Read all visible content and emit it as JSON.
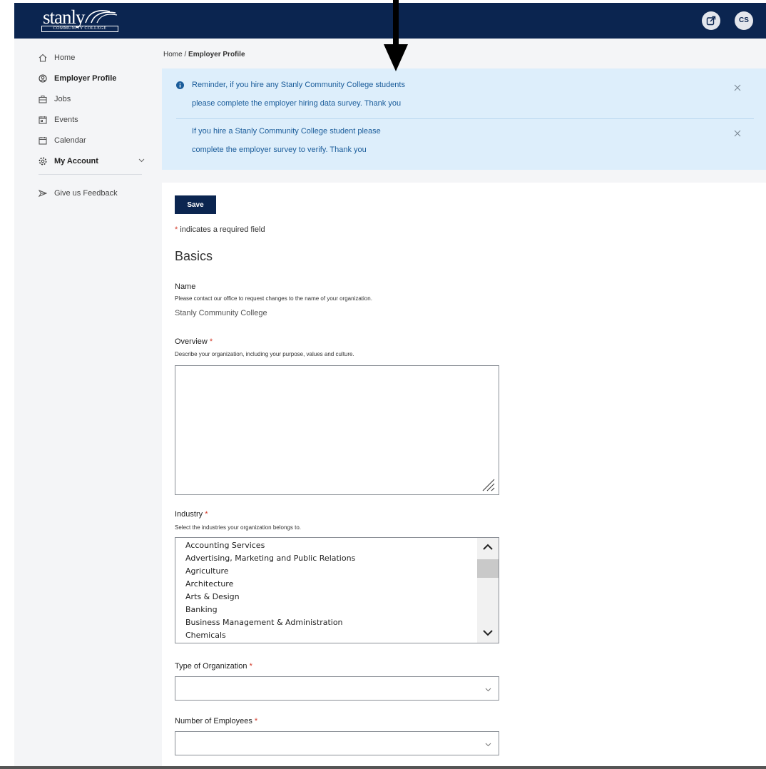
{
  "logo": {
    "wordmark": "stanly",
    "subline": "COMMUNITY COLLEGE"
  },
  "header": {
    "avatar_initials": "CS"
  },
  "sidebar": {
    "items": [
      {
        "label": "Home"
      },
      {
        "label": "Employer Profile"
      },
      {
        "label": "Jobs"
      },
      {
        "label": "Events"
      },
      {
        "label": "Calendar"
      },
      {
        "label": "My Account"
      },
      {
        "label": "Give us Feedback"
      }
    ]
  },
  "breadcrumb": {
    "home": "Home",
    "separator": "/",
    "current": "Employer Profile"
  },
  "alerts": [
    {
      "line1": "Reminder, if you hire any Stanly Community College students",
      "line2": "please complete the employer hiring data survey.  Thank you"
    },
    {
      "line1": "If you hire a Stanly Community College student please",
      "line2": "complete the employer survey to verify.  Thank you"
    }
  ],
  "form": {
    "save_label": "Save",
    "required_note": "indicates a required field",
    "required_star": "*",
    "section_title": "Basics",
    "name": {
      "label": "Name",
      "help": "Please contact our office to request changes to the name of your organization.",
      "value": "Stanly Community College"
    },
    "overview": {
      "label": "Overview",
      "help": "Describe your organization, including your purpose, values and culture.",
      "value": ""
    },
    "industry": {
      "label": "Industry",
      "help": "Select the industries your organization belongs to.",
      "options": [
        "Accounting Services",
        "Advertising, Marketing and Public Relations",
        "Agriculture",
        "Architecture",
        "Arts & Design",
        "Banking",
        "Business Management & Administration",
        "Chemicals"
      ]
    },
    "org_type": {
      "label": "Type of Organization",
      "value": ""
    },
    "employees": {
      "label": "Number of Employees",
      "value": ""
    }
  },
  "colors": {
    "brand_navy": "#0b2550",
    "alert_bg": "#ddeefb",
    "alert_text": "#1a5c9a",
    "required": "#d23a2a"
  }
}
